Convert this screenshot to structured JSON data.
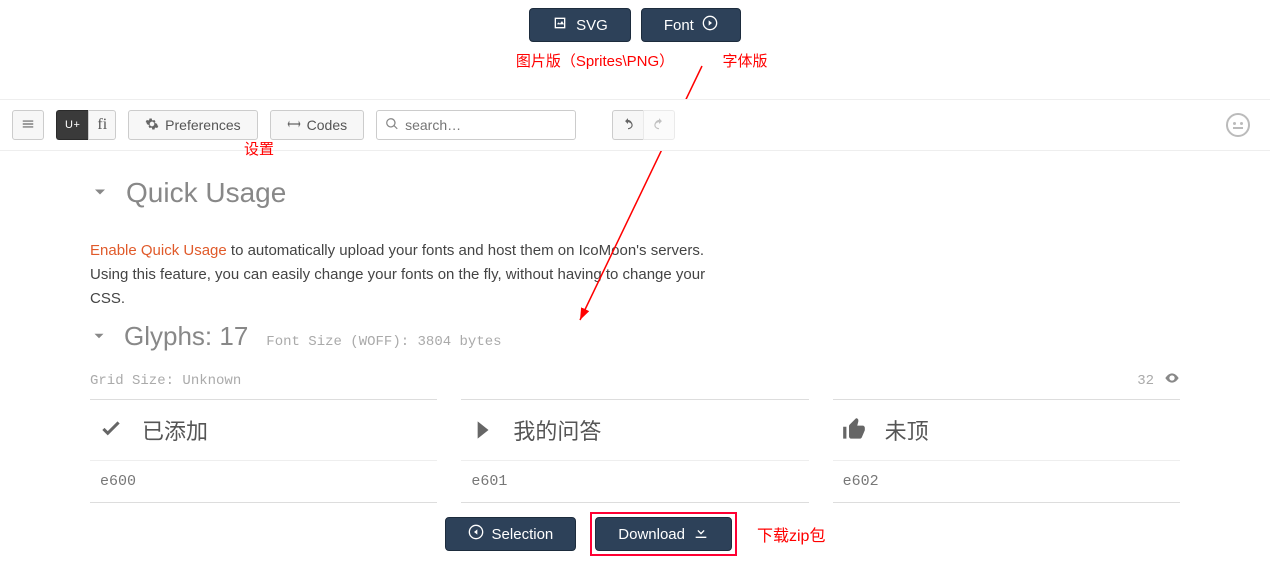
{
  "top": {
    "svg_label": "SVG",
    "font_label": "Font"
  },
  "annotations": {
    "img_version": "图片版（Sprites\\PNG）",
    "font_version": "字体版",
    "settings": "设置",
    "download_zip": "下载zip包"
  },
  "toolbar": {
    "u_plus": "U+",
    "fi": "fi",
    "preferences": "Preferences",
    "codes": "Codes",
    "search_placeholder": "search…"
  },
  "quick_usage": {
    "title": "Quick Usage",
    "link_text": "Enable Quick Usage",
    "desc_rest": " to automatically upload your fonts and host them on IcoMoon's servers. Using this feature, you can easily change your fonts on the fly, without having to change your CSS."
  },
  "glyphs": {
    "title": "Glyphs: 17",
    "meta": "Font Size (WOFF): 3804 bytes",
    "grid_size": "Grid Size: Unknown",
    "count": "32",
    "items": [
      {
        "label": "已添加",
        "code": "e600",
        "icon": "check"
      },
      {
        "label": "我的问答",
        "code": "e601",
        "icon": "chevron-right"
      },
      {
        "label": "未顶",
        "code": "e602",
        "icon": "thumbs-up"
      }
    ]
  },
  "bottom": {
    "selection": "Selection",
    "download": "Download"
  }
}
